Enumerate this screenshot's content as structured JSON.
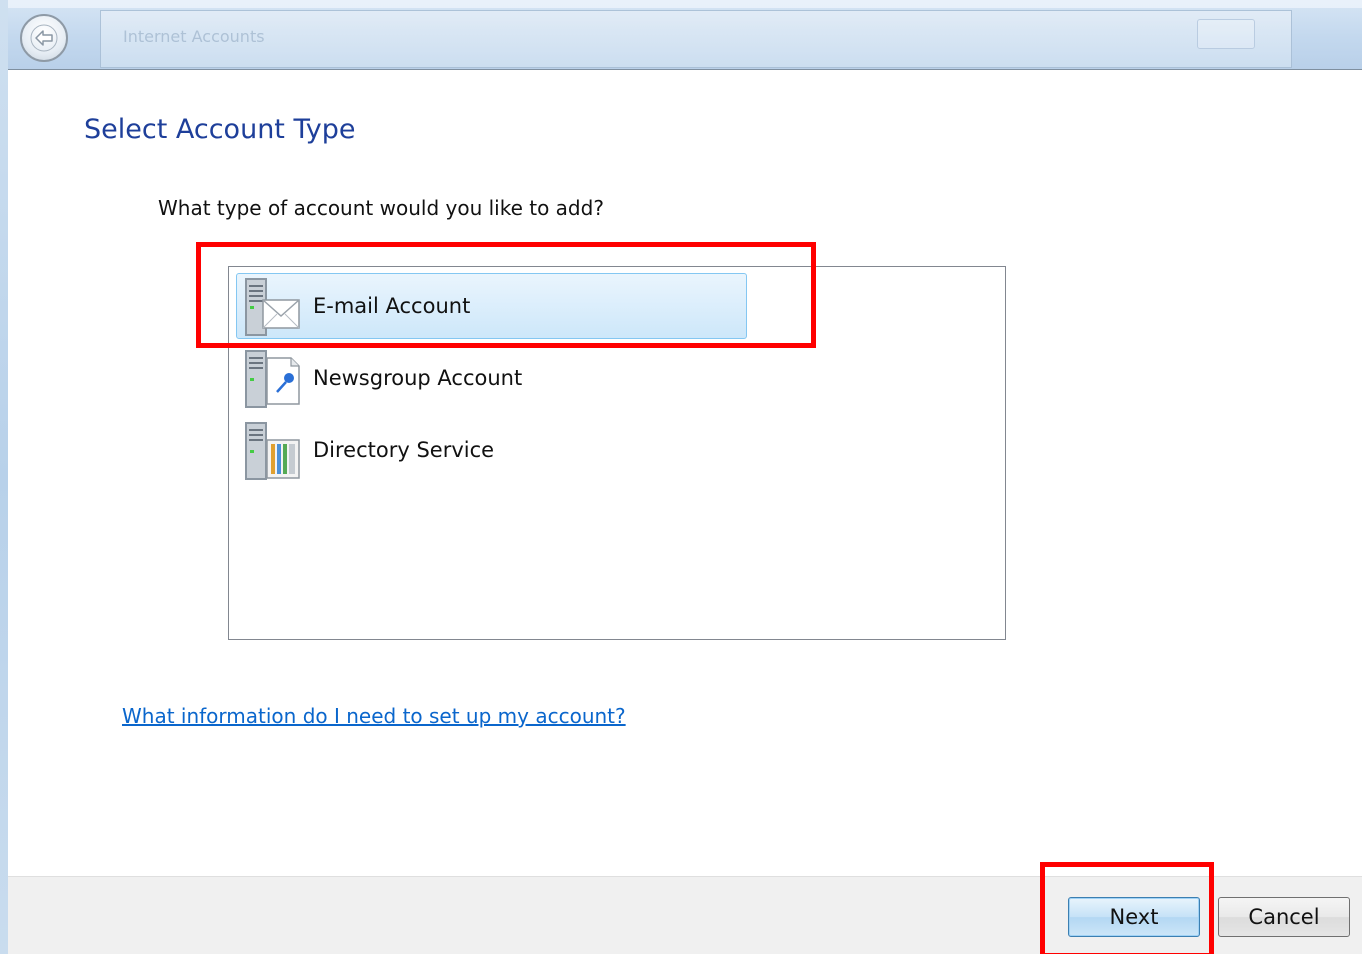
{
  "page": {
    "title": "Select Account Type",
    "question": "What type of account would you like to add?"
  },
  "window": {
    "title_faded": "Internet Accounts"
  },
  "accounts": [
    {
      "label": "E-mail Account",
      "icon": "email-server-icon",
      "selected": true
    },
    {
      "label": "Newsgroup Account",
      "icon": "newsgroup-server-icon",
      "selected": false
    },
    {
      "label": "Directory Service",
      "icon": "directory-server-icon",
      "selected": false
    }
  ],
  "help": {
    "link_text": "What information do I need to set up my account?"
  },
  "buttons": {
    "next": "Next",
    "cancel": "Cancel"
  },
  "colors": {
    "title": "#1e3f9a",
    "link": "#0a66cc",
    "selection_fill": "#cde7fa",
    "selection_border": "#84c7f2",
    "annotation": "#ff0000"
  }
}
